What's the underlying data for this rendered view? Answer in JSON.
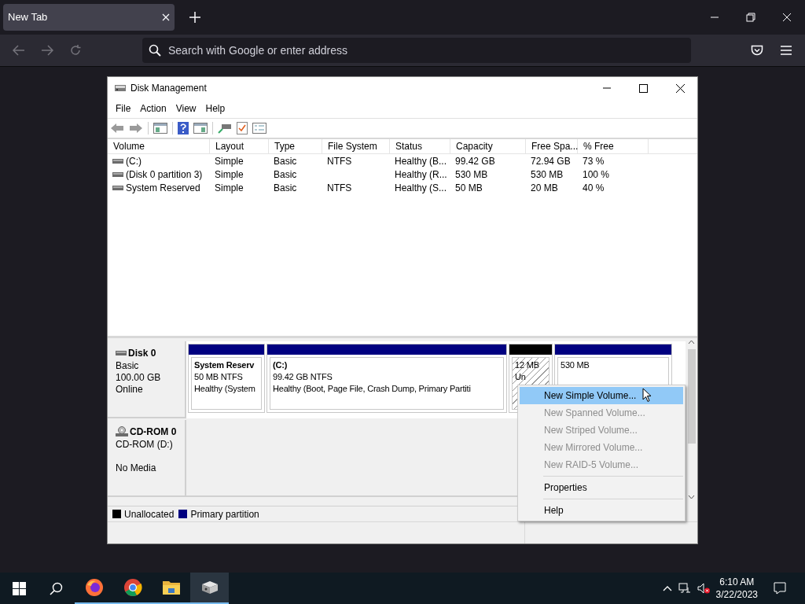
{
  "browser": {
    "tab": {
      "title": "New Tab",
      "selected": true
    },
    "address": {
      "placeholder": "Search with Google or enter address"
    }
  },
  "window": {
    "title": "Disk Management",
    "menu": [
      "File",
      "Action",
      "View",
      "Help"
    ],
    "columns": [
      "Volume",
      "Layout",
      "Type",
      "File System",
      "Status",
      "Capacity",
      "Free Spa...",
      "% Free"
    ],
    "rows": [
      {
        "cells": [
          "(C:)",
          "Simple",
          "Basic",
          "NTFS",
          "Healthy (B...",
          "99.42 GB",
          "72.94 GB",
          "73 %"
        ]
      },
      {
        "cells": [
          "(Disk 0 partition 3)",
          "Simple",
          "Basic",
          "",
          "Healthy (R...",
          "530 MB",
          "530 MB",
          "100 %"
        ]
      },
      {
        "cells": [
          "System Reserved",
          "Simple",
          "Basic",
          "NTFS",
          "Healthy (S...",
          "50 MB",
          "20 MB",
          "40 %"
        ]
      }
    ],
    "disks": [
      {
        "kind": "disk",
        "name": "Disk 0",
        "lines": [
          "Basic",
          "100.00 GB",
          "Online"
        ],
        "partitions": [
          {
            "kind": "primary",
            "title": "System Reserv",
            "lines": [
              "50 MB NTFS",
              "Healthy (System"
            ]
          },
          {
            "kind": "primary",
            "title": "(C:)",
            "lines": [
              "99.42 GB NTFS",
              "Healthy (Boot, Page File, Crash Dump, Primary Partiti"
            ]
          },
          {
            "kind": "unallocated",
            "lines": [
              "12 MB",
              "Un"
            ]
          },
          {
            "kind": "primary",
            "lines": [
              "530 MB"
            ]
          }
        ]
      },
      {
        "kind": "cdrom",
        "name": "CD-ROM 0",
        "lines": [
          "CD-ROM (D:)",
          "No Media"
        ]
      }
    ],
    "legend": [
      {
        "label": "Unallocated",
        "color": "#000000"
      },
      {
        "label": "Primary partition",
        "color": "#000080"
      }
    ],
    "context_menu": [
      {
        "kind": "item",
        "label": "New Simple Volume...",
        "disabled": false,
        "selected": true
      },
      {
        "kind": "item",
        "label": "New Spanned Volume...",
        "disabled": true,
        "selected": false
      },
      {
        "kind": "item",
        "label": "New Striped Volume...",
        "disabled": true,
        "selected": false
      },
      {
        "kind": "item",
        "label": "New Mirrored Volume...",
        "disabled": true,
        "selected": false
      },
      {
        "kind": "item",
        "label": "New RAID-5 Volume...",
        "disabled": true,
        "selected": false
      },
      {
        "kind": "separator"
      },
      {
        "kind": "item",
        "label": "Properties",
        "disabled": false,
        "selected": false
      },
      {
        "kind": "separator"
      },
      {
        "kind": "item",
        "label": "Help",
        "disabled": false,
        "selected": false
      }
    ]
  },
  "taskbar": {
    "apps": [
      {
        "kind": "firefox",
        "selected": false
      },
      {
        "kind": "chrome",
        "selected": false
      },
      {
        "kind": "explorer",
        "selected": false
      },
      {
        "kind": "diskmgmt",
        "selected": true
      }
    ],
    "time": "6:10 AM",
    "date": "3/22/2023"
  }
}
